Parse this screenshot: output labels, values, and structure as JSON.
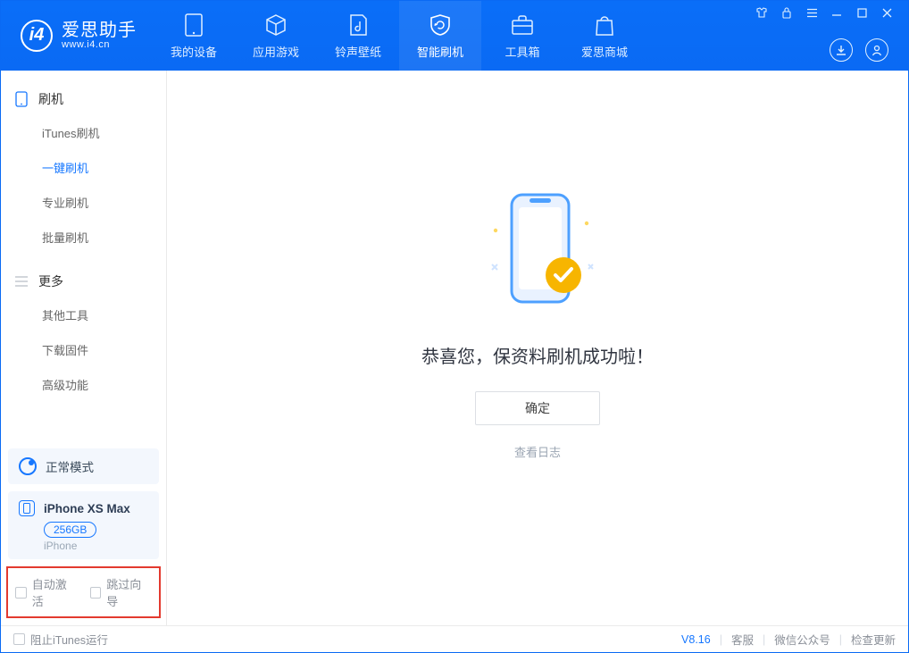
{
  "app": {
    "title_cn": "爱思助手",
    "title_en": "www.i4.cn"
  },
  "nav": {
    "my_device": "我的设备",
    "apps_games": "应用游戏",
    "ring_wall": "铃声壁纸",
    "smart_flash": "智能刷机",
    "toolbox": "工具箱",
    "store": "爱思商城"
  },
  "sidebar": {
    "cat_flash": "刷机",
    "items_flash": {
      "itunes": "iTunes刷机",
      "oneclick": "一键刷机",
      "pro": "专业刷机",
      "batch": "批量刷机"
    },
    "cat_more": "更多",
    "items_more": {
      "other": "其他工具",
      "firmware": "下载固件",
      "advanced": "高级功能"
    }
  },
  "mode": {
    "label": "正常模式"
  },
  "device": {
    "name": "iPhone XS Max",
    "capacity": "256GB",
    "type": "iPhone"
  },
  "checks": {
    "auto_activate": "自动激活",
    "skip_guide": "跳过向导"
  },
  "main": {
    "success_msg": "恭喜您，保资料刷机成功啦！",
    "ok": "确定",
    "view_log": "查看日志"
  },
  "status": {
    "block_itunes": "阻止iTunes运行",
    "version": "V8.16",
    "support": "客服",
    "wechat": "微信公众号",
    "check_update": "检查更新"
  }
}
